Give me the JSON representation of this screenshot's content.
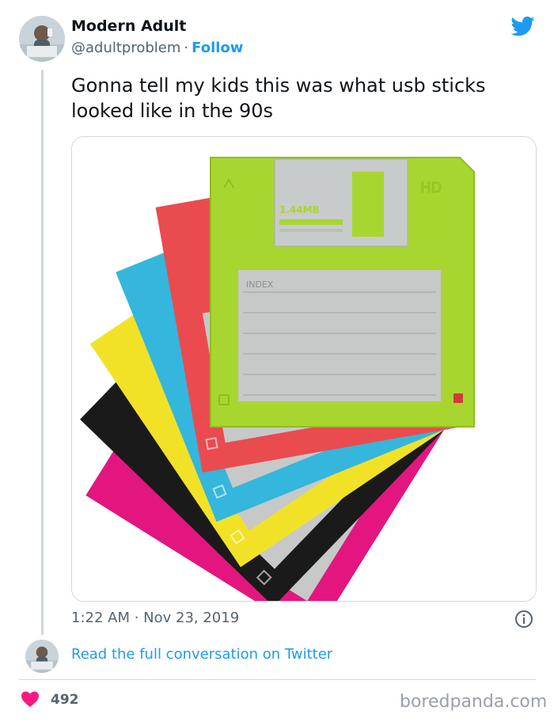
{
  "author": {
    "name": "Modern Adult",
    "handle": "@adultproblem",
    "separator": "·",
    "follow_label": "Follow"
  },
  "tweet": {
    "text": "Gonna tell my kids this was what usb sticks looked like in the 90s",
    "timestamp": "1:22 AM · Nov 23, 2019"
  },
  "media": {
    "floppy_capacity": "1.44MB",
    "floppy_hd_mark": "HD",
    "floppy_label_title": "INDEX",
    "disk_colors": [
      "#e3167f",
      "#1a1a1a",
      "#f2e227",
      "#35b6dc",
      "#ea4b4f",
      "#a8d630"
    ]
  },
  "footer": {
    "read_link": "Read the full conversation on Twitter",
    "likes": "492",
    "watermark": "boredpanda.com"
  },
  "icons": {
    "twitter": "twitter-bird-icon",
    "info": "info-icon",
    "heart": "heart-icon"
  },
  "colors": {
    "link": "#1d9bf0",
    "heart": "#f91880",
    "muted": "#536471"
  }
}
